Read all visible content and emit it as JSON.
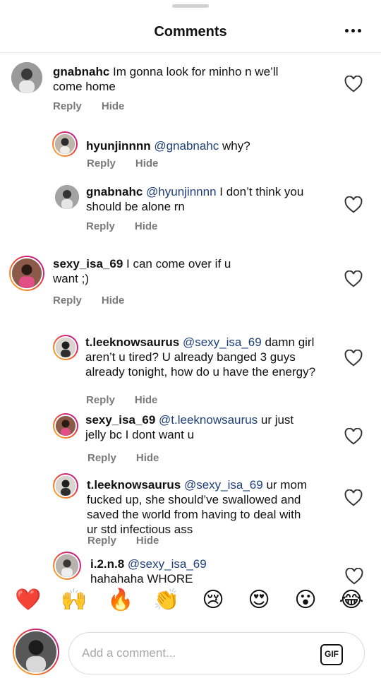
{
  "header": {
    "title": "Comments"
  },
  "comments": [
    {
      "user": "gnabnahc",
      "mention": "",
      "body": "Im gonna look for minho n we’ll come home",
      "reply": "Reply",
      "hide": "Hide"
    },
    {
      "user": "hyunjinnnn",
      "mention": "@gnabnahc",
      "body": "why?",
      "reply": "Reply",
      "hide": "Hide"
    },
    {
      "user": "gnabnahc",
      "mention": "@hyunjinnnn",
      "body": "I don’t think you should be alone rn",
      "reply": "Reply",
      "hide": "Hide"
    },
    {
      "user": "sexy_isa_69",
      "mention": "",
      "body": "I can come over if u want ;)",
      "reply": "Reply",
      "hide": "Hide"
    },
    {
      "user": "t.leeknowsaurus",
      "mention": "@sexy_isa_69",
      "body": "damn girl aren’t u tired? U already banged 3 guys already tonight, how do u have the energy?",
      "reply": "Reply",
      "hide": "Hide"
    },
    {
      "user": "sexy_isa_69",
      "mention": "@t.leeknowsaurus",
      "body": "ur just jelly bc I dont want u",
      "reply": "Reply",
      "hide": "Hide"
    },
    {
      "user": "t.leeknowsaurus",
      "mention": "@sexy_isa_69",
      "body": "ur mom fucked up, she should’ve swallowed and saved the world from having to deal with ur std infectious ass",
      "reply": "Reply",
      "hide": "Hide"
    },
    {
      "user": "i.2.n.8",
      "mention": "@sexy_isa_69",
      "body": "hahahaha WHORE",
      "reply": "",
      "hide": ""
    }
  ],
  "emoji_bar": [
    "❤️",
    "🙌",
    "🔥",
    "👏",
    "😢",
    "😍",
    "😮",
    "😂"
  ],
  "emoji_names": [
    "heart",
    "raised-hands",
    "fire",
    "clapping-hands",
    "crying-face",
    "heart-eyes",
    "surprised-face",
    "tears-of-joy"
  ],
  "composer": {
    "placeholder": "Add a comment...",
    "gif_label": "GIF"
  },
  "colors": {
    "mention": "#1d3f78",
    "muted": "#7a7a7a",
    "ring_start": "#f9c42c",
    "ring_end": "#b0149a"
  }
}
